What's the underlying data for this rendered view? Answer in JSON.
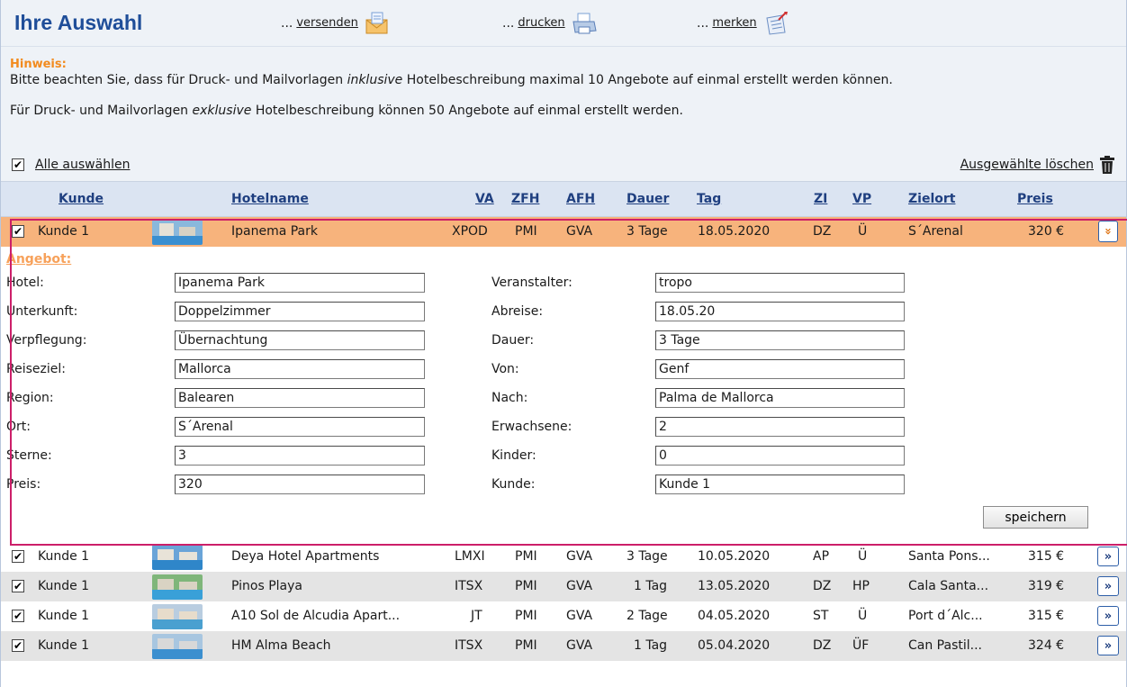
{
  "header": {
    "title": "Ihre Auswahl",
    "actions": [
      {
        "dots": "...",
        "label": "versenden",
        "icon": "envelope-icon"
      },
      {
        "dots": "...",
        "label": "drucken",
        "icon": "printer-icon"
      },
      {
        "dots": "...",
        "label": "merken",
        "icon": "notepad-icon"
      }
    ]
  },
  "notice": {
    "hint": "Hinweis:",
    "line1_pre": "Bitte beachten Sie, dass für Druck- und Mailvorlagen ",
    "line1_em": "inklusive",
    "line1_post": " Hotelbeschreibung maximal 10 Angebote auf einmal erstellt werden können.",
    "line2_pre": "Für Druck- und Mailvorlagen ",
    "line2_em": "exklusive",
    "line2_post": " Hotelbeschreibung können 50 Angebote auf einmal erstellt werden."
  },
  "selection": {
    "select_all": "Alle auswählen",
    "delete_selected": "Ausgewählte löschen",
    "check": "✔"
  },
  "columns": {
    "kunde": "Kunde",
    "hotelname": "Hotelname",
    "va": "VA",
    "zfh": "ZFH",
    "afh": "AFH",
    "dauer": "Dauer",
    "tag": "Tag",
    "zi": "ZI",
    "vp": "VP",
    "zielort": "Zielort",
    "preis": "Preis"
  },
  "selected_row": {
    "kunde": "Kunde 1",
    "hotel": "Ipanema Park",
    "va": "XPOD",
    "zfh": "PMI",
    "afh": "GVA",
    "dauer": "3 Tage",
    "tag": "18.05.2020",
    "zi": "DZ",
    "vp": "Ü",
    "zielort": "S´Arenal",
    "preis": "320 €",
    "toggle": "»"
  },
  "detail": {
    "heading": "Angebot:",
    "left": [
      {
        "label": "Hotel:",
        "value": "Ipanema Park"
      },
      {
        "label": "Unterkunft:",
        "value": "Doppelzimmer"
      },
      {
        "label": "Verpflegung:",
        "value": "Übernachtung"
      },
      {
        "label": "Reiseziel:",
        "value": "Mallorca"
      },
      {
        "label": "Region:",
        "value": "Balearen"
      },
      {
        "label": "Ort:",
        "value": "S´Arenal"
      },
      {
        "label": "Sterne:",
        "value": "3"
      },
      {
        "label": "Preis:",
        "value": "320"
      }
    ],
    "right": [
      {
        "label": "Veranstalter:",
        "value": "tropo"
      },
      {
        "label": "Abreise:",
        "value": "18.05.20"
      },
      {
        "label": "Dauer:",
        "value": "3 Tage"
      },
      {
        "label": "Von:",
        "value": "Genf"
      },
      {
        "label": "Nach:",
        "value": "Palma de Mallorca"
      },
      {
        "label": "Erwachsene:",
        "value": "2"
      },
      {
        "label": "Kinder:",
        "value": "0"
      },
      {
        "label": "Kunde:",
        "value": "Kunde 1"
      }
    ],
    "save": "speichern"
  },
  "rows": [
    {
      "kunde": "Kunde 1",
      "hotel": "Deya Hotel Apartments",
      "va": "LMXI",
      "zfh": "PMI",
      "afh": "GVA",
      "dauer": "3 Tage",
      "tag": "10.05.2020",
      "zi": "AP",
      "vp": "Ü",
      "zielort": "Santa Pons...",
      "preis": "315 €",
      "toggle": "»"
    },
    {
      "kunde": "Kunde 1",
      "hotel": "Pinos Playa",
      "va": "ITSX",
      "zfh": "PMI",
      "afh": "GVA",
      "dauer": "1 Tag",
      "tag": "13.05.2020",
      "zi": "DZ",
      "vp": "HP",
      "zielort": "Cala Santa...",
      "preis": "319 €",
      "toggle": "»"
    },
    {
      "kunde": "Kunde 1",
      "hotel": "A10 Sol de Alcudia Apart...",
      "va": "JT",
      "zfh": "PMI",
      "afh": "GVA",
      "dauer": "2 Tage",
      "tag": "04.05.2020",
      "zi": "ST",
      "vp": "Ü",
      "zielort": "Port d´Alc...",
      "preis": "315 €",
      "toggle": "»"
    },
    {
      "kunde": "Kunde 1",
      "hotel": "HM Alma Beach",
      "va": "ITSX",
      "zfh": "PMI",
      "afh": "GVA",
      "dauer": "1 Tag",
      "tag": "05.04.2020",
      "zi": "DZ",
      "vp": "ÜF",
      "zielort": "Can Pastil...",
      "preis": "324 €",
      "toggle": "»"
    }
  ]
}
